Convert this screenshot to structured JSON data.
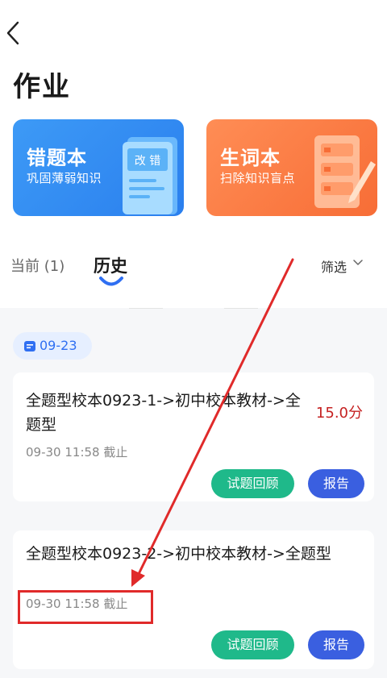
{
  "header": {
    "back_icon": "chevron-left-icon",
    "title": "作业"
  },
  "cards": {
    "wrong_book": {
      "title": "错题本",
      "subtitle": "巩固薄弱知识",
      "art_label": "改 错",
      "color": "#3d9af6"
    },
    "vocab_book": {
      "title": "生词本",
      "subtitle": "扫除知识盲点",
      "color": "#f76d36"
    }
  },
  "tabs": {
    "current": "当前 (1)",
    "history": "历史",
    "active": "history",
    "filter_label": "筛选",
    "filter_icon": "chevron-down-icon"
  },
  "groups": [
    {
      "date": "09-23",
      "items": [
        {
          "title": "全题型校本0923-1->初中校本教材->全题型",
          "score": "15.0分",
          "deadline": "09-30 11:58 截止",
          "review_label": "试题回顾",
          "report_label": "报告"
        },
        {
          "title": "全题型校本0923-2->初中校本教材->全题型",
          "deadline": "09-30 11:58 截止",
          "review_label": "试题回顾",
          "report_label": "报告"
        }
      ]
    }
  ],
  "colors": {
    "accent_blue": "#2f6ff2",
    "review_green": "#1fb98a",
    "report_blue": "#3a5fe0",
    "score_red": "#c52121",
    "annotation_red": "#e02a2a"
  }
}
